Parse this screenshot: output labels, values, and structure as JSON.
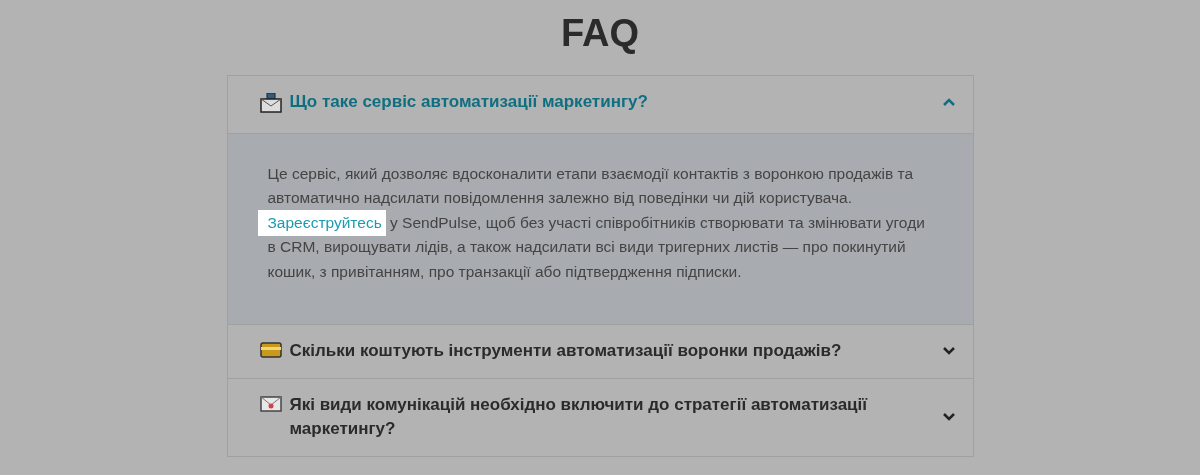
{
  "title": "FAQ",
  "items": [
    {
      "kind": "mailbox",
      "question": "Що таке сервіс автоматизації маркетингу?",
      "expanded": true,
      "answer": {
        "before": "Це сервіс, який дозволяє вдосконалити етапи взаємодії контактів з воронкою продажів та автоматично надсилати повідомлення залежно від поведінки чи дій користувача.",
        "link": "Зареєструйтесь",
        "after": "у SendPulse, щоб без участі співробітників створювати та змінювати угоди в CRM, вирощувати лідів, а також надсилати всі види тригерних листів — про покинутий кошик, з привітанням, про транзакції або підтвердження підписки."
      }
    },
    {
      "kind": "card",
      "question": "Скільки коштують інструменти автоматизації воронки продажів?",
      "expanded": false
    },
    {
      "kind": "letter",
      "question": "Які види комунікацій необхідно включити до стратегії автоматизації маркетингу?",
      "expanded": false
    }
  ]
}
